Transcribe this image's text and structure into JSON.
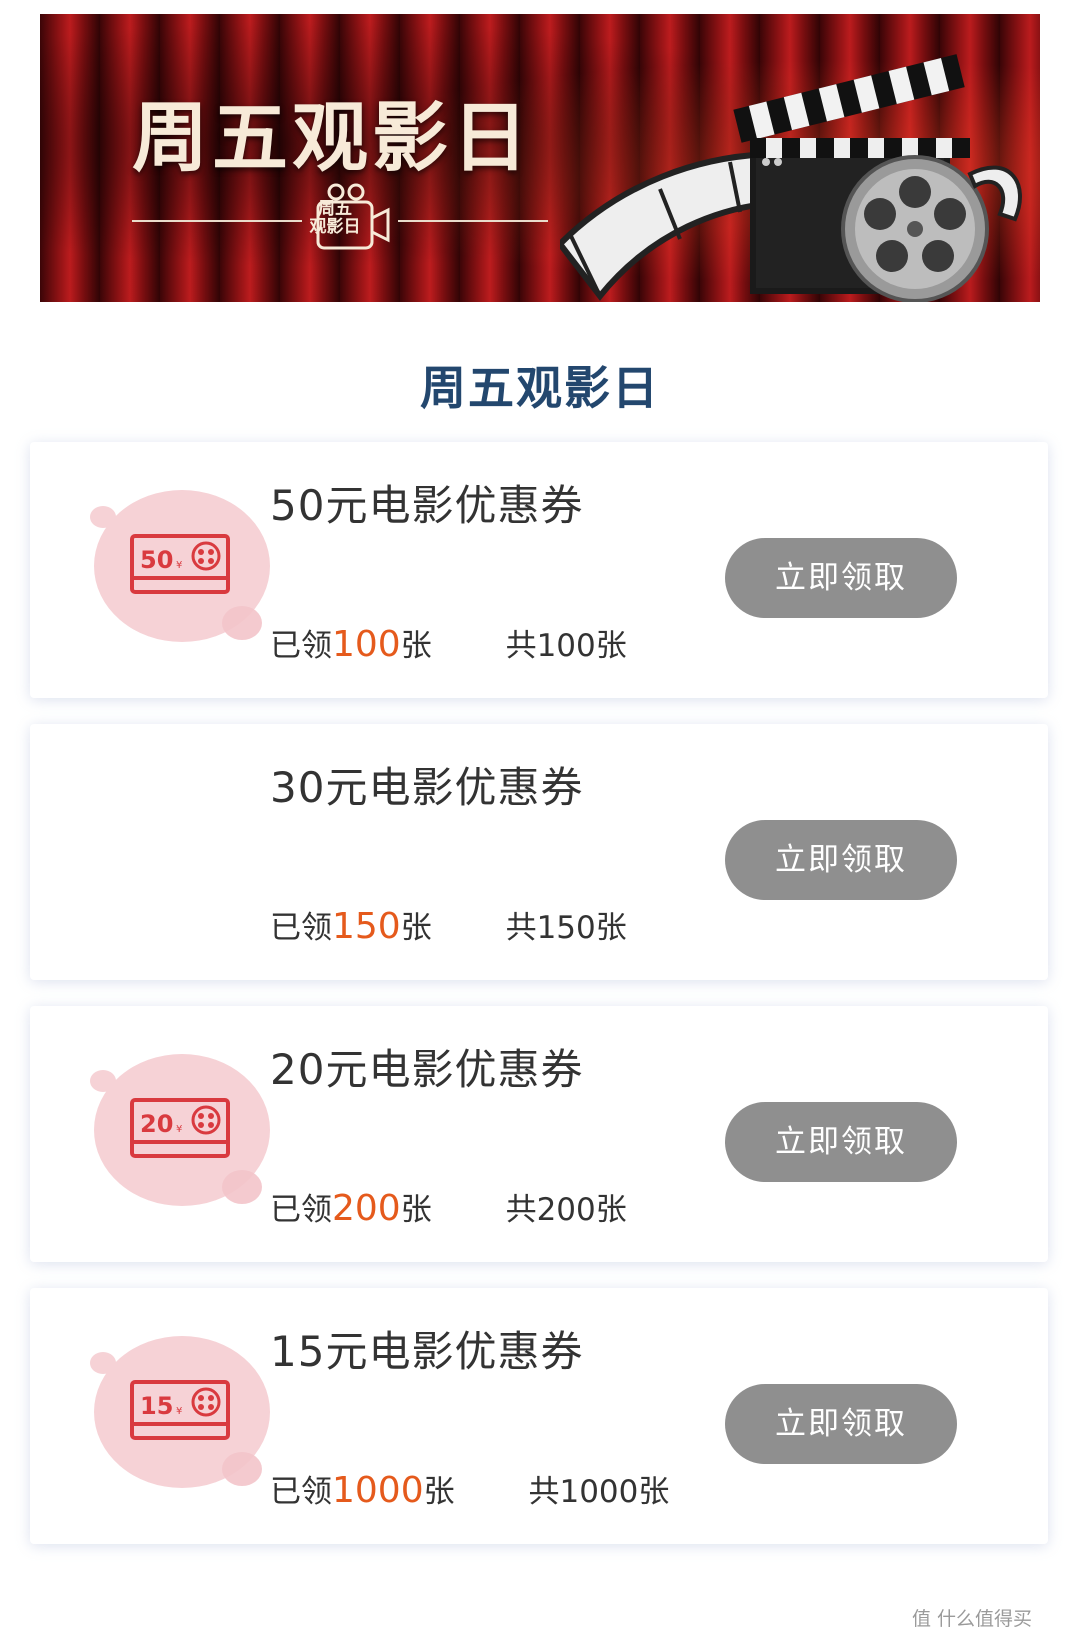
{
  "banner": {
    "title": "周五观影日",
    "logo_line1": "周五",
    "logo_line2": "观影日"
  },
  "section": {
    "title": "周五观影日"
  },
  "coupons": [
    {
      "title": "50元电影优惠券",
      "badge": "50",
      "claimed_prefix": "已领",
      "claimed": "100",
      "claimed_suffix": "张",
      "total": "共100张",
      "button": "立即领取",
      "show_icon": true
    },
    {
      "title": "30元电影优惠券",
      "badge": "",
      "claimed_prefix": "已领",
      "claimed": "150",
      "claimed_suffix": "张",
      "total": "共150张",
      "button": "立即领取",
      "show_icon": false
    },
    {
      "title": "20元电影优惠券",
      "badge": "20",
      "claimed_prefix": "已领",
      "claimed": "200",
      "claimed_suffix": "张",
      "total": "共200张",
      "button": "立即领取",
      "show_icon": true
    },
    {
      "title": "15元电影优惠券",
      "badge": "15",
      "claimed_prefix": "已领",
      "claimed": "1000",
      "claimed_suffix": "张",
      "total": "共1000张",
      "button": "立即领取",
      "show_icon": true
    }
  ],
  "watermark": "值 什么值得买",
  "colors": {
    "accent": "#e55a1c",
    "section_title": "#23476e",
    "button_bg": "#8f8f8f",
    "ticket_red": "#d93a3f",
    "blob": "#f6d2d6"
  }
}
